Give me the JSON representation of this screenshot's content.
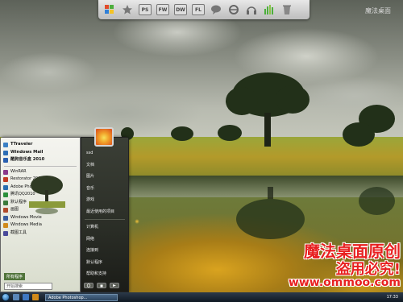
{
  "dock": {
    "items": [
      {
        "name": "windows-logo-icon"
      },
      {
        "name": "star-icon"
      },
      {
        "name": "photoshop-icon",
        "label": "PS"
      },
      {
        "name": "fireworks-icon",
        "label": "FW"
      },
      {
        "name": "dreamweaver-icon",
        "label": "DW"
      },
      {
        "name": "flash-icon",
        "label": "FL"
      },
      {
        "name": "chat-bubble-icon"
      },
      {
        "name": "internet-explorer-icon"
      },
      {
        "name": "headphones-icon"
      },
      {
        "name": "equalizer-icon"
      },
      {
        "name": "recycle-bin-icon"
      }
    ]
  },
  "top_watermark": "魔法桌面",
  "start_menu": {
    "programs": [
      {
        "label": "TTraveler",
        "bold": true,
        "color": "#3a7fc4"
      },
      {
        "label": "Windows Mail",
        "bold": true,
        "color": "#2d6db5"
      },
      {
        "label": "酷狗音乐盒 2010",
        "bold": true,
        "color": "#2a5fb0"
      },
      {
        "label": "WinRAR",
        "bold": false,
        "color": "#8a3a8a"
      },
      {
        "label": "Restorator 2007",
        "bold": false,
        "color": "#c23b22"
      },
      {
        "label": "Adobe Photoshop",
        "bold": false,
        "color": "#2a6fb0"
      },
      {
        "label": "腾讯QQ2010",
        "bold": false,
        "color": "#2a8f3a"
      },
      {
        "label": "默认程序",
        "bold": false,
        "color": "#3a7a3a"
      },
      {
        "label": "画图",
        "bold": false,
        "color": "#b04a2a"
      },
      {
        "label": "Windows Movie",
        "bold": false,
        "color": "#3a5fa0"
      },
      {
        "label": "Windows Media",
        "bold": false,
        "color": "#d08a1a"
      },
      {
        "label": "截图工具",
        "bold": false,
        "color": "#4a4a9a"
      }
    ],
    "all_programs_label": "所有程序",
    "search_placeholder": "开始搜索",
    "right_links": [
      "ssd",
      "文档",
      "图片",
      "音乐",
      "游戏",
      "最近使用的项目",
      "计算机",
      "网络",
      "连接到",
      "默认程序",
      "帮助和支持"
    ],
    "power_buttons": [
      "power-button",
      "lock-button",
      "arrow-button"
    ]
  },
  "taskbar": {
    "task_label": "Adobe Photoshop...",
    "clock": "17:33"
  },
  "watermark": {
    "line1": "魔法桌面原创",
    "line2": "盗用必究!",
    "line3": "www.ommoo.com"
  }
}
